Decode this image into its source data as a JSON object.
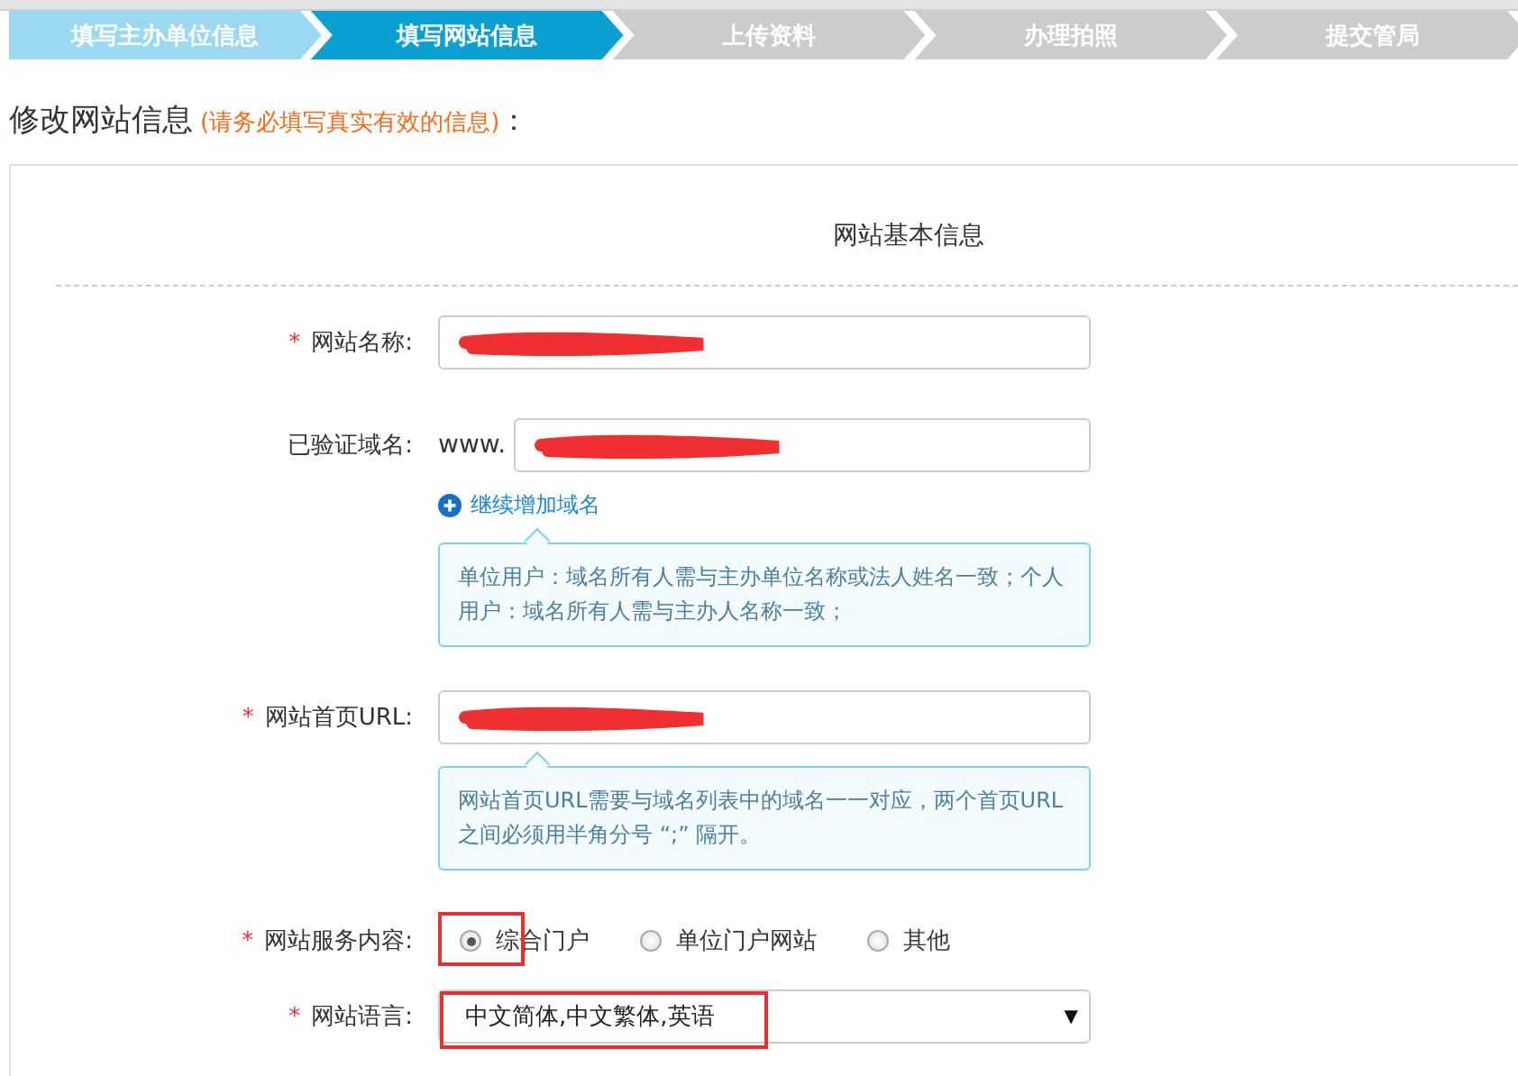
{
  "steps": [
    {
      "label": "填写主办单位信息",
      "kind": "done"
    },
    {
      "label": "填写网站信息",
      "kind": "active"
    },
    {
      "label": "上传资料",
      "kind": "todo"
    },
    {
      "label": "办理拍照",
      "kind": "todo"
    },
    {
      "label": "提交管局",
      "kind": "todo"
    }
  ],
  "page_title": "修改网站信息",
  "page_hint": "(请务必填写真实有效的信息)",
  "title_colon": "：",
  "section_title": "网站基本信息",
  "fields": [
    {
      "kind": "text",
      "required_mark": "*",
      "label": "网站名称:",
      "redacted": true
    },
    {
      "kind": "domain",
      "label": "已验证域名:",
      "prefix": "www.",
      "redacted": true,
      "add_link": "继续增加域名",
      "tip": "单位用户：域名所有人需与主办单位名称或法人姓名一致；个人用户：域名所有人需与主办人名称一致；"
    },
    {
      "kind": "text",
      "required_mark": "*",
      "label": "网站首页URL:",
      "redacted": true,
      "tip": "网站首页URL需要与域名列表中的域名一一对应，两个首页URL之间必须用半角分号 “;” 隔开。"
    },
    {
      "kind": "radio",
      "required_mark": "*",
      "label": "网站服务内容:",
      "options": [
        {
          "label": "综合门户",
          "selected": true,
          "annotated": true
        },
        {
          "label": "单位门户网站",
          "selected": false,
          "annotated": false
        },
        {
          "label": "其他",
          "selected": false,
          "annotated": false
        }
      ]
    },
    {
      "kind": "select",
      "required_mark": "*",
      "label": "网站语言:",
      "value": "中文简体,中文繁体,英语",
      "caret": "▼",
      "annotated": true
    }
  ]
}
